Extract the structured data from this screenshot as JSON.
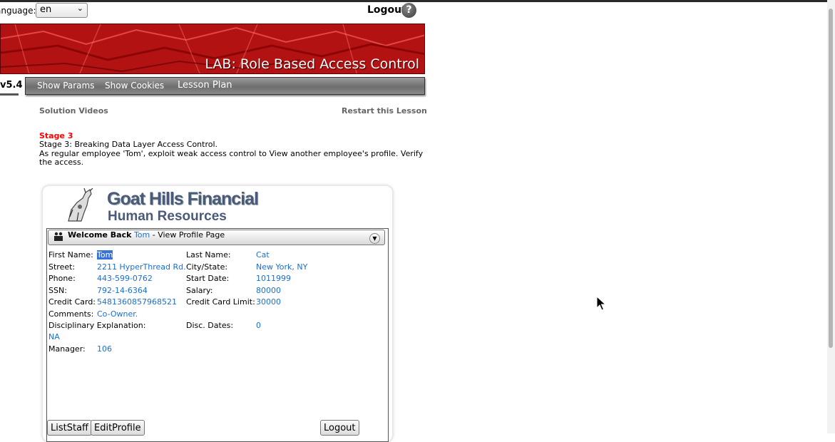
{
  "header": {
    "language_label": "anguage:",
    "language_value": "en",
    "logout_label": "Logout",
    "help_glyph": "?"
  },
  "banner": {
    "title": "LAB: Role Based Access Control",
    "color": "#b31212"
  },
  "version": "v5.4",
  "nav": {
    "items": [
      "Show Params",
      "Show Cookies",
      "Lesson Plan"
    ]
  },
  "lesson": {
    "solution_videos": "Solution Videos",
    "restart": "Restart this Lesson",
    "stage_title": "Stage 3",
    "stage_desc": "Stage 3: Breaking Data Layer Access Control.",
    "instructions_1": "As regular employee 'Tom', exploit weak access control to View another employee's profile. Verify",
    "instructions_2": "the access."
  },
  "app": {
    "logo_line1": "Goat Hills Financial",
    "logo_line2": "Human Resources",
    "welcome_prefix": "Welcome Back",
    "user": "Tom",
    "page_suffix": "- View Profile Page",
    "fields": {
      "first_name_label": "First Name:",
      "first_name": "Tom",
      "last_name_label": "Last Name:",
      "last_name": "Cat",
      "street_label": "Street:",
      "street": "2211 HyperThread Rd.",
      "city_label": "City/State:",
      "city": "New York, NY",
      "phone_label": "Phone:",
      "phone": "443-599-0762",
      "start_date_label": "Start Date:",
      "start_date": "1011999",
      "ssn_label": "SSN:",
      "ssn": "792-14-6364",
      "salary_label": "Salary:",
      "salary": "80000",
      "credit_card_label": "Credit Card:",
      "credit_card": "5481360857968521",
      "credit_limit_label": "Credit Card Limit:",
      "credit_limit": "30000",
      "comments_label": "Comments:",
      "comments": "Co-Owner.",
      "disciplinary_label": "Disciplinary Explanation:",
      "disciplinary": "NA",
      "disc_dates_label": "Disc. Dates:",
      "disc_dates": "0",
      "manager_label": "Manager:",
      "manager": "106"
    },
    "buttons": {
      "list_staff": "ListStaff",
      "edit_profile": "EditProfile",
      "logout": "Logout"
    }
  },
  "icons": [
    "chevron-down-icon",
    "help-icon",
    "people-icon",
    "collapse-icon",
    "mouse-cursor-icon",
    "goat-logo-icon"
  ],
  "colors": {
    "link": "#1a6fd1",
    "stage": "#ff0000",
    "nav_bg": "#7a7a7a"
  }
}
